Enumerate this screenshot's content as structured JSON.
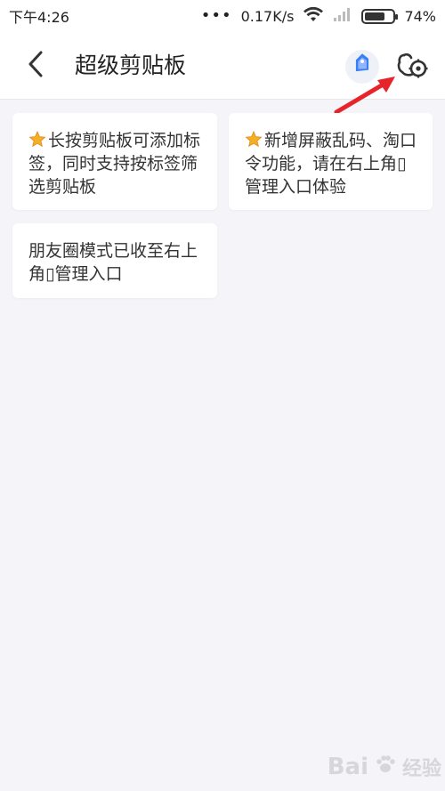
{
  "status_bar": {
    "time": "下午4:26",
    "dots": "•••",
    "network_speed": "0.17K/s",
    "battery_percent": "74%",
    "battery_level": 0.74
  },
  "header": {
    "title": "超级剪贴板"
  },
  "icons": {
    "back": "chevron-left-icon",
    "tag": "tag-icon",
    "manage": "manage-settings-icon",
    "star": "star-icon",
    "wifi": "wifi-icon",
    "signal": "signal-icon",
    "battery": "battery-icon"
  },
  "colors": {
    "background": "#f4f4f9",
    "card": "#ffffff",
    "accent_blue": "#3b7ff5",
    "annotation_red": "#e8242b",
    "star_gold": "#f4b024"
  },
  "clips": [
    {
      "text": "长按剪贴板可添加标签，同时支持按标签筛选剪贴板",
      "starred": true
    },
    {
      "text": "新增屏蔽乱码、淘口令功能，请在右上角▯管理入口体验",
      "starred": true
    },
    {
      "text": "朋友圈模式已收至右上角▯管理入口",
      "starred": false
    }
  ],
  "watermark": {
    "brand": "Bai",
    "suffix": "经验"
  }
}
